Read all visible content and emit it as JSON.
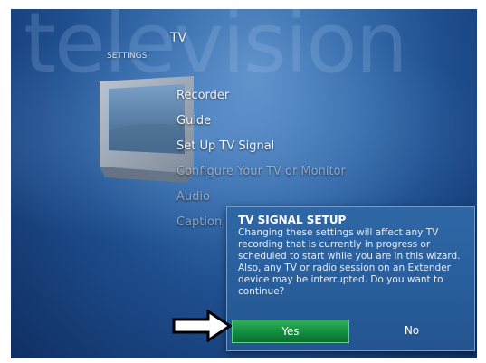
{
  "background": {
    "watermark": "television"
  },
  "breadcrumb": {
    "section": "TV",
    "page": "SETTINGS"
  },
  "menu": {
    "items": [
      {
        "label": "Recorder"
      },
      {
        "label": "Guide"
      },
      {
        "label": "Set Up TV Signal"
      },
      {
        "label": "Configure Your TV or Monitor"
      },
      {
        "label": "Audio"
      },
      {
        "label": "Caption"
      }
    ]
  },
  "dialog": {
    "title": "TV SIGNAL SETUP",
    "message": "Changing these settings will affect any TV recording that is currently in progress or scheduled to start while you are in this wizard. Also, any TV or radio session on an Extender device may be interrupted. Do you want to continue?",
    "yes_label": "Yes",
    "no_label": "No"
  },
  "colors": {
    "selected_button": "#138c3e",
    "dialog_background": "#2b609f",
    "screen_background": "#1f4f8f"
  },
  "icons": {
    "tv_illustration": "television-icon",
    "pointer": "arrow-right-icon"
  }
}
